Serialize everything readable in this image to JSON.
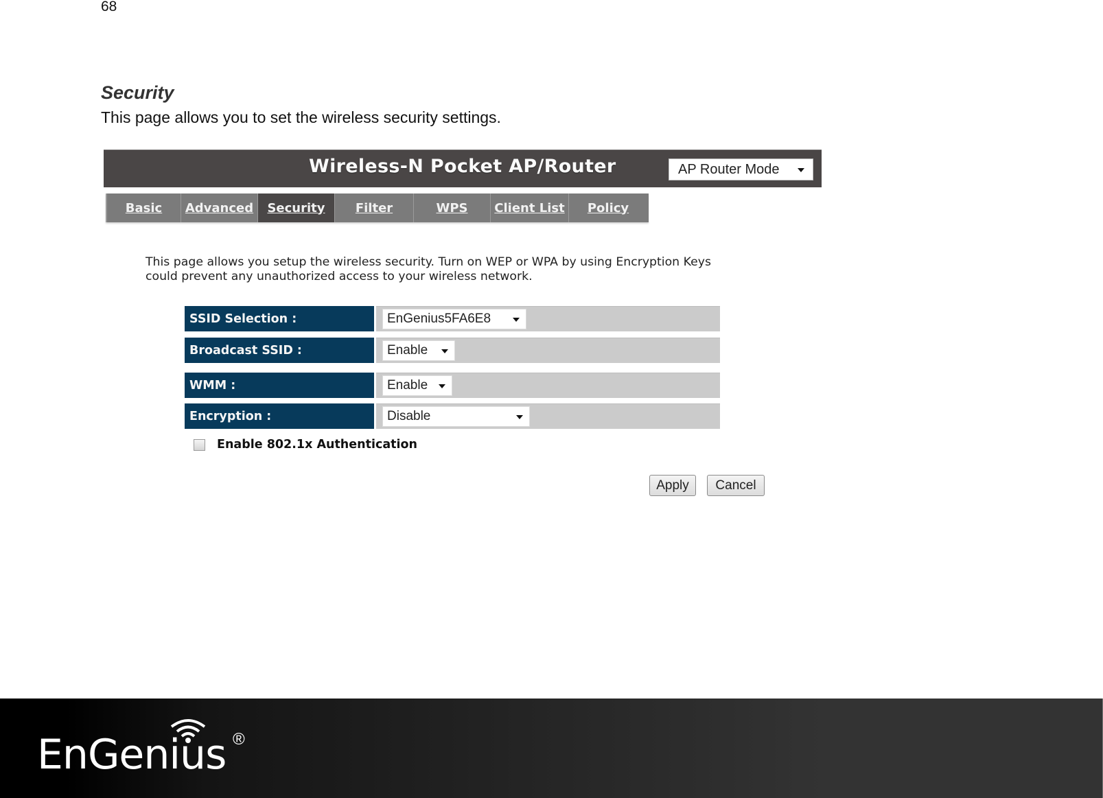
{
  "document": {
    "page_number": "68",
    "title": "Security",
    "description": "This page allows you to set the wireless security settings."
  },
  "router_ui": {
    "header": {
      "title": "Wireless-N Pocket AP/Router",
      "mode_select": {
        "value": "AP Router Mode",
        "icon": "chevron-down-icon"
      }
    },
    "tabs": [
      {
        "label": "Basic",
        "active": false
      },
      {
        "label": "Advanced",
        "active": false
      },
      {
        "label": "Security",
        "active": true
      },
      {
        "label": "Filter",
        "active": false
      },
      {
        "label": "WPS",
        "active": false
      },
      {
        "label": "Client List",
        "active": false
      },
      {
        "label": "Policy",
        "active": false
      }
    ],
    "description_line1": "This page allows you setup the wireless security. Turn on WEP or WPA by using Encryption Keys",
    "description_line2": "could prevent any unauthorized access to your wireless network.",
    "form": {
      "rows": [
        {
          "label": "SSID Selection :",
          "value": "EnGenius5FA6E8"
        },
        {
          "label": "Broadcast SSID :",
          "value": "Enable"
        },
        {
          "label": "WMM :",
          "value": "Enable"
        },
        {
          "label": "Encryption :",
          "value": "Disable"
        }
      ],
      "auth_checkbox": {
        "label": "Enable 802.1x Authentication",
        "checked": false
      }
    },
    "buttons": {
      "apply": "Apply",
      "cancel": "Cancel"
    },
    "colors": {
      "header_bg": "#4a4646",
      "tab_bg": "#7b7b7b",
      "tab_active_bg": "#4a4747",
      "label_bg": "#073a5b",
      "value_bg": "#cbcbcb"
    }
  },
  "footer": {
    "brand": "EnGenius",
    "registered": "®",
    "icon": "wifi-icon"
  }
}
